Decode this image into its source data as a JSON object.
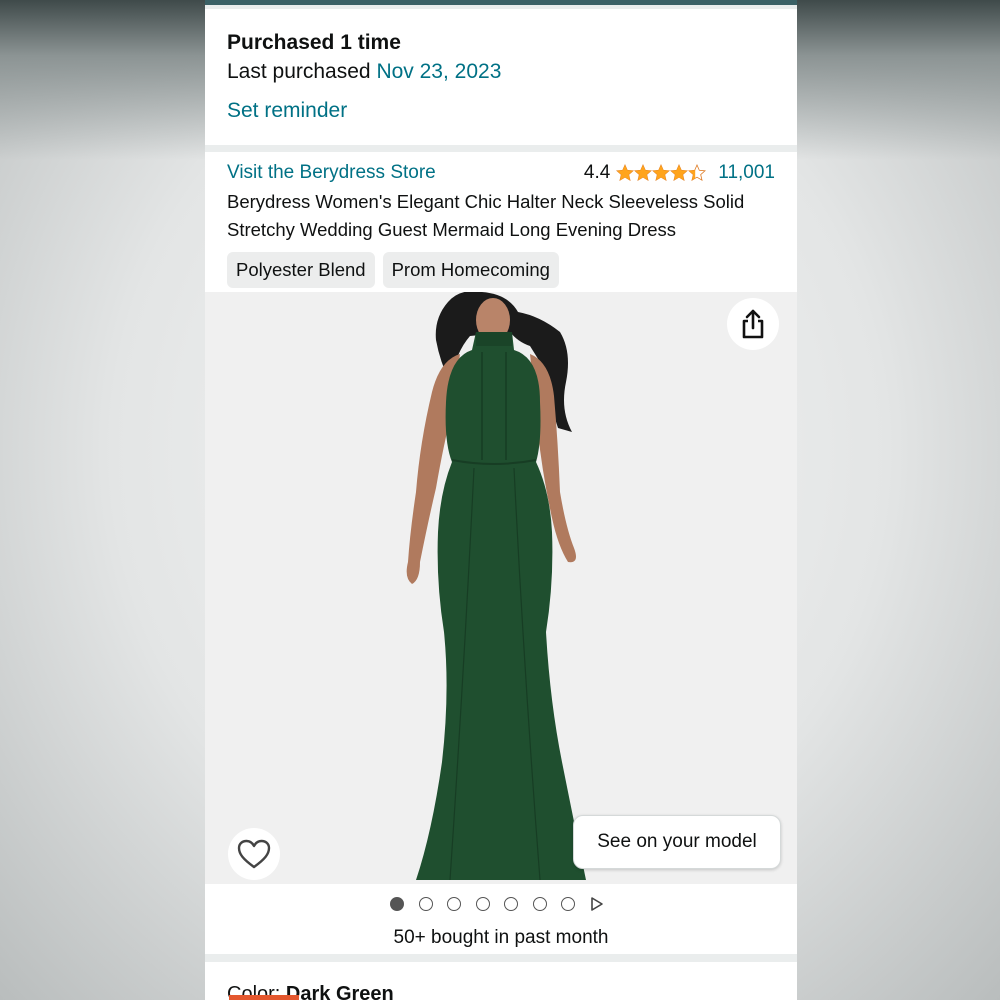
{
  "purchase": {
    "purchased_text": "Purchased 1 time",
    "last_purchased_label": "Last purchased",
    "last_purchased_date": "Nov 23, 2023",
    "set_reminder": "Set reminder"
  },
  "product": {
    "store_link": "Visit the Berydress Store",
    "rating_value": "4.4",
    "rating_stars": 4.4,
    "review_count": "11,001",
    "title": "Berydress Women's Elegant Chic Halter Neck Sleeveless Solid Stretchy Wedding Guest Mermaid Long Evening Dress",
    "chips": [
      "Polyester Blend",
      "Prom Homecoming"
    ],
    "accent_link_color": "#007185",
    "star_color": "#ffa41c"
  },
  "image": {
    "share_icon": "share-icon",
    "heart_icon": "heart-icon",
    "see_on_model": "See on your model",
    "dress_color": "#1f4f2f"
  },
  "carousel": {
    "dot_count": 7,
    "active_index": 0,
    "next_icon": "play-triangle-icon"
  },
  "social_proof": {
    "bought_text": "50+ bought in past month"
  },
  "color_selector": {
    "label": "Color:",
    "value": "Dark Green"
  }
}
